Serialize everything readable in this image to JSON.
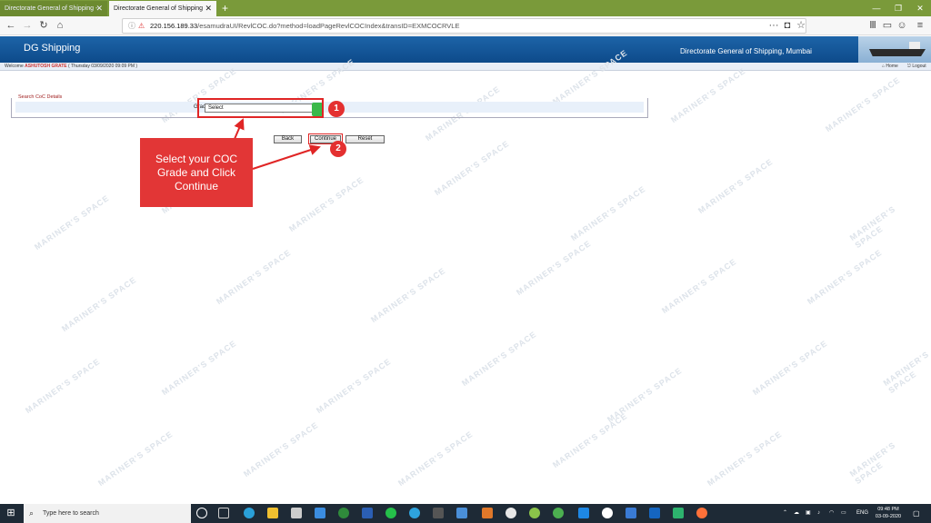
{
  "browser": {
    "tabs": [
      {
        "label": "Directorate General of Shipping - U..."
      },
      {
        "label": "Directorate General of Shipping"
      }
    ],
    "new_tab": "+",
    "url_host": "220.156.189.33",
    "url_path": "/esamudraUI/RevlCOC.do?method=loadPageRevlCOCIndex&transID=EXMCOCRVLE"
  },
  "header": {
    "logo": "DG Shipping",
    "org_name": "Directorate General of Shipping, Mumbai"
  },
  "welcome_bar": {
    "prefix": "Welcome",
    "user": "ASHUTOSH GRATE",
    "datetime": "( Thursday 03/09/2020 09:09 PM )",
    "home": "Home",
    "logout": "Logout"
  },
  "form": {
    "legend": "Search CoC Details",
    "grade_label": "Grade :",
    "grade_value": "Select"
  },
  "buttons": {
    "back": "Back",
    "continue": "Continue",
    "reset": "Reset"
  },
  "annotations": {
    "badge1": "1",
    "badge2": "2",
    "callout": "Select your COC Grade and Click Continue",
    "accent": "#e23636"
  },
  "watermark": {
    "text": "MARINER'S SPACE"
  },
  "taskbar": {
    "search_placeholder": "Type here to search",
    "lang": "ENG",
    "time": "09:48 PM",
    "date": "03-09-2020"
  }
}
